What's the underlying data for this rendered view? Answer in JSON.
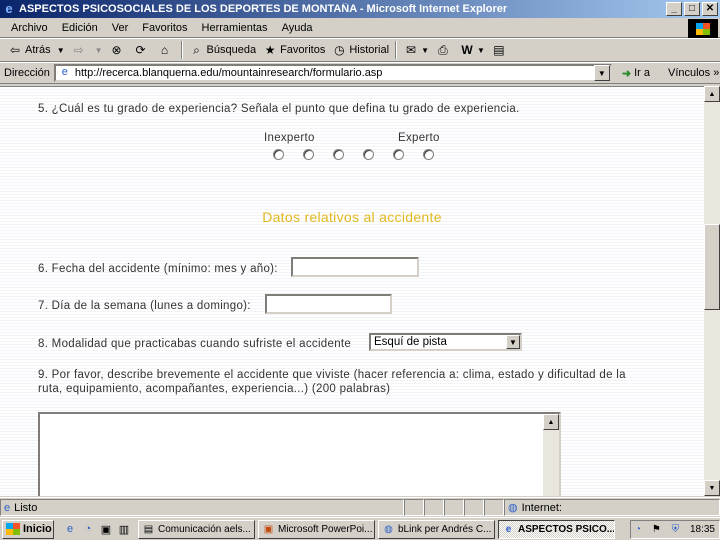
{
  "window": {
    "title": "ASPECTOS PSICOSOCIALES DE LOS DEPORTES DE MONTAÑA - Microsoft Internet Explorer",
    "buttons": {
      "minimize": "_",
      "maximize": "□",
      "close": "✕"
    }
  },
  "menu": [
    "Archivo",
    "Edición",
    "Ver",
    "Favoritos",
    "Herramientas",
    "Ayuda"
  ],
  "toolbar": {
    "back": "Atrás",
    "search": "Búsqueda",
    "favorites": "Favoritos",
    "history": "Historial"
  },
  "address": {
    "label": "Dirección",
    "url": "http://recerca.blanquerna.edu/mountainresearch/formulario.asp",
    "go": "Ir a",
    "links": "Vínculos »"
  },
  "form": {
    "q5": "5. ¿Cuál es tu grado de experiencia? Señala el punto que defina tu grado de experiencia.",
    "scale_low": "Inexperto",
    "scale_high": "Experto",
    "section_title": "Datos relativos al accidente",
    "q6": "6. Fecha del accidente (mínimo: mes y año):",
    "q7": "7. Día de la semana (lunes a domingo):",
    "q8": "8. Modalidad que practicabas cuando sufriste el accidente",
    "q8_selected": "Esquí de pista",
    "q9_line1": "9. Por favor, describe brevemente el accidente que viviste (hacer referencia a: clima, estado y dificultad de la",
    "q9_line2": "ruta, equipamiento, acompañantes, experiencia...) (200 palabras)"
  },
  "status": {
    "text": "Listo",
    "zone": "Internet"
  },
  "taskbar": {
    "start": "Inicio",
    "tasks": [
      "Comunicación aels...",
      "Microsoft PowerPoi...",
      "bLink per Andrés C...",
      "ASPECTOS PSICO..."
    ],
    "clock": "18:35"
  }
}
